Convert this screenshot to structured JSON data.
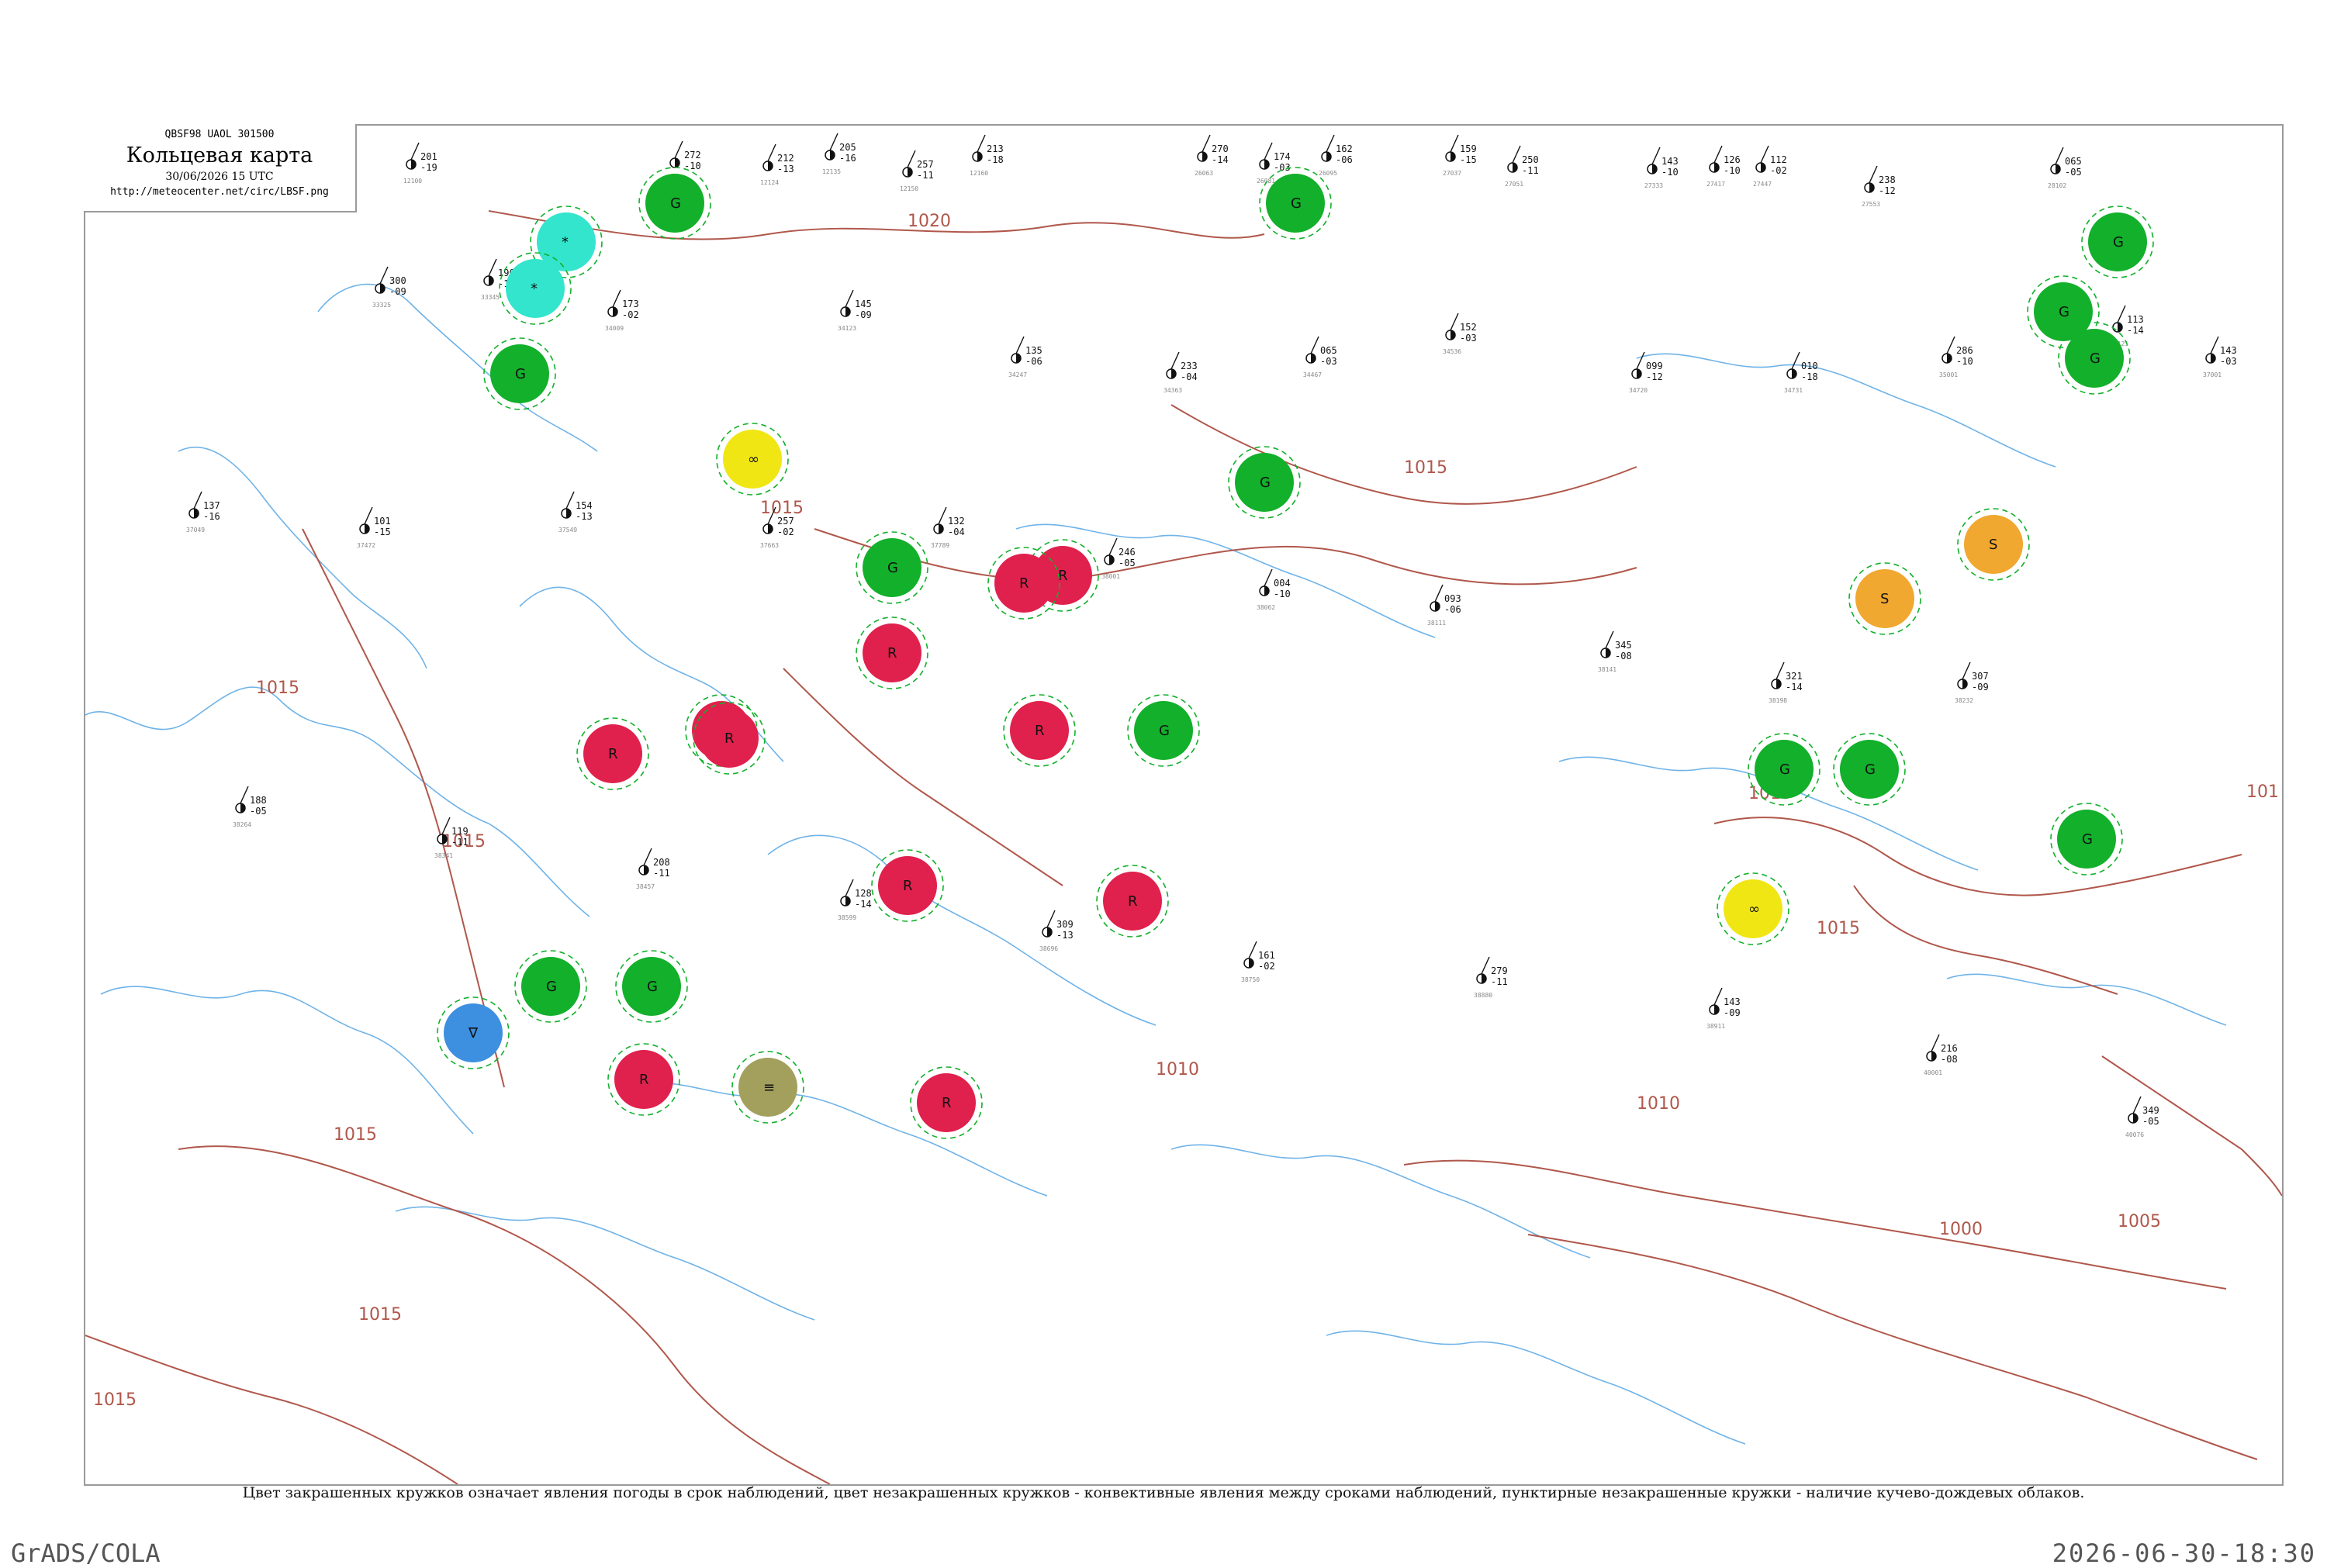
{
  "header": {
    "code_line": "QBSF98   UAOL   301500",
    "title": "Кольцевая карта",
    "datetime": "30/06/2026 15 UTC",
    "url": "http://meteocenter.net/circ/LBSF.png"
  },
  "caption": "Цвет закрашенных кружков означает явления погоды в срок наблюдений, цвет незакрашенных кружков - конвективные явления между сроками наблюдений, пунктирные незакрашенные кружки - наличие кучево-дождевых облаков.",
  "footer": {
    "left": "GrADS/COLA",
    "right": "2026-06-30-18:30"
  },
  "colors": {
    "isobar": "#b0574b",
    "water": "#6fb3e8",
    "rain": "#13b02b",
    "thunderstorm": "#e0214d",
    "fog": "#a3a05e",
    "shower": "#3d8fe0",
    "snow": "#33e5cc",
    "haze": "#f0e614",
    "dust": "#f0a830",
    "cb_circle": "#13b02b"
  },
  "isobar_labels": [
    "1020",
    "1015",
    "1015",
    "1015",
    "1015",
    "1015",
    "1015",
    "1015",
    "1010",
    "1010",
    "1005",
    "1000",
    "101",
    "1015",
    "1015"
  ],
  "stations": [
    {
      "p": "201",
      "dp": "-19",
      "id": "12100"
    },
    {
      "p": "272",
      "dp": "-10",
      "id": "12120"
    },
    {
      "p": "212",
      "dp": "-13",
      "id": "12124"
    },
    {
      "p": "205",
      "dp": "-16",
      "id": "12135"
    },
    {
      "p": "257",
      "dp": "-11",
      "id": "12150"
    },
    {
      "p": "213",
      "dp": "-18",
      "id": "12160"
    },
    {
      "p": "270",
      "dp": "-14",
      "id": "26063"
    },
    {
      "p": "174",
      "dp": "-03",
      "id": "26081"
    },
    {
      "p": "162",
      "dp": "-06",
      "id": "26095"
    },
    {
      "p": "159",
      "dp": "-15",
      "id": "27037"
    },
    {
      "p": "250",
      "dp": "-11",
      "id": "27051"
    },
    {
      "p": "143",
      "dp": "-10",
      "id": "27333"
    },
    {
      "p": "126",
      "dp": "-10",
      "id": "27417"
    },
    {
      "p": "112",
      "dp": "-02",
      "id": "27447"
    },
    {
      "p": "238",
      "dp": "-12",
      "id": "27553"
    },
    {
      "p": "065",
      "dp": "-05",
      "id": "28102"
    },
    {
      "p": "300",
      "dp": "-09",
      "id": "33325"
    },
    {
      "p": "190",
      "dp": "-16",
      "id": "33345"
    },
    {
      "p": "173",
      "dp": "-02",
      "id": "34009"
    },
    {
      "p": "145",
      "dp": "-09",
      "id": "34123"
    },
    {
      "p": "135",
      "dp": "-06",
      "id": "34247"
    },
    {
      "p": "233",
      "dp": "-04",
      "id": "34363"
    },
    {
      "p": "065",
      "dp": "-03",
      "id": "34467"
    },
    {
      "p": "152",
      "dp": "-03",
      "id": "34536"
    },
    {
      "p": "099",
      "dp": "-12",
      "id": "34720"
    },
    {
      "p": "010",
      "dp": "-18",
      "id": "34731"
    },
    {
      "p": "286",
      "dp": "-10",
      "id": "35001"
    },
    {
      "p": "113",
      "dp": "-14",
      "id": "35121"
    },
    {
      "p": "143",
      "dp": "-03",
      "id": "37001"
    },
    {
      "p": "137",
      "dp": "-16",
      "id": "37049"
    },
    {
      "p": "101",
      "dp": "-15",
      "id": "37472"
    },
    {
      "p": "154",
      "dp": "-13",
      "id": "37549"
    },
    {
      "p": "257",
      "dp": "-02",
      "id": "37663"
    },
    {
      "p": "132",
      "dp": "-04",
      "id": "37789"
    },
    {
      "p": "246",
      "dp": "-05",
      "id": "38001"
    },
    {
      "p": "004",
      "dp": "-10",
      "id": "38062"
    },
    {
      "p": "093",
      "dp": "-06",
      "id": "38111"
    },
    {
      "p": "345",
      "dp": "-08",
      "id": "38141"
    },
    {
      "p": "321",
      "dp": "-14",
      "id": "38198"
    },
    {
      "p": "307",
      "dp": "-09",
      "id": "38232"
    },
    {
      "p": "188",
      "dp": "-05",
      "id": "38264"
    },
    {
      "p": "119",
      "dp": "-11",
      "id": "38341"
    },
    {
      "p": "208",
      "dp": "-11",
      "id": "38457"
    },
    {
      "p": "128",
      "dp": "-14",
      "id": "38599"
    },
    {
      "p": "309",
      "dp": "-13",
      "id": "38696"
    },
    {
      "p": "161",
      "dp": "-02",
      "id": "38750"
    },
    {
      "p": "279",
      "dp": "-11",
      "id": "38880"
    },
    {
      "p": "143",
      "dp": "-09",
      "id": "38911"
    },
    {
      "p": "216",
      "dp": "-08",
      "id": "40001"
    },
    {
      "p": "349",
      "dp": "-05",
      "id": "40076"
    }
  ],
  "weather_circles": [
    {
      "type": "rain",
      "label": "G"
    },
    {
      "type": "rain",
      "label": "G"
    },
    {
      "type": "rain",
      "label": "G"
    },
    {
      "type": "rain",
      "label": "G"
    },
    {
      "type": "rain",
      "label": "G"
    },
    {
      "type": "rain",
      "label": "G"
    },
    {
      "type": "rain",
      "label": "G"
    },
    {
      "type": "rain",
      "label": "G"
    },
    {
      "type": "rain",
      "label": "G"
    },
    {
      "type": "rain",
      "label": "G"
    },
    {
      "type": "rain",
      "label": "G"
    },
    {
      "type": "rain",
      "label": "G"
    },
    {
      "type": "rain",
      "label": "G"
    },
    {
      "type": "rain",
      "label": "G"
    },
    {
      "type": "thunderstorm",
      "label": "R"
    },
    {
      "type": "thunderstorm",
      "label": "R"
    },
    {
      "type": "thunderstorm",
      "label": "R"
    },
    {
      "type": "thunderstorm",
      "label": "R"
    },
    {
      "type": "thunderstorm",
      "label": "R"
    },
    {
      "type": "thunderstorm",
      "label": "R"
    },
    {
      "type": "thunderstorm",
      "label": "R"
    },
    {
      "type": "thunderstorm",
      "label": "R"
    },
    {
      "type": "thunderstorm",
      "label": "R"
    },
    {
      "type": "thunderstorm",
      "label": "R"
    },
    {
      "type": "thunderstorm",
      "label": "R"
    },
    {
      "type": "fog",
      "label": "≡"
    },
    {
      "type": "shower",
      "label": "∇"
    },
    {
      "type": "snow",
      "label": "*"
    },
    {
      "type": "snow",
      "label": "*"
    },
    {
      "type": "haze",
      "label": "∞"
    },
    {
      "type": "haze",
      "label": "∞"
    },
    {
      "type": "dust",
      "label": "S"
    },
    {
      "type": "dust",
      "label": "S"
    }
  ]
}
